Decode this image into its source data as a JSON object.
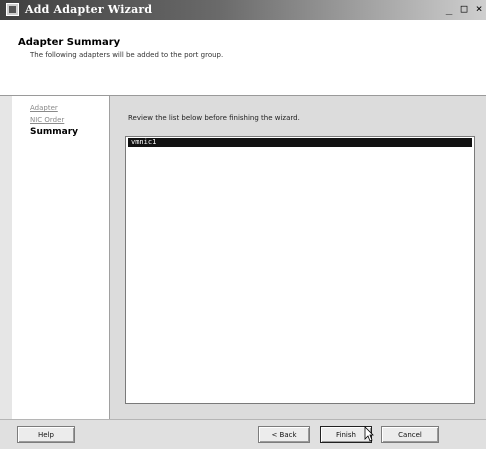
{
  "window": {
    "title": "Add Adapter Wizard",
    "controls": {
      "minimize": "_",
      "maximize": "□",
      "close": "×"
    }
  },
  "header": {
    "title": "Adapter Summary",
    "subtitle": "The following adapters will be added to the port group."
  },
  "steps": [
    {
      "label": "Adapter",
      "state": "link"
    },
    {
      "label": "NIC Order",
      "state": "link"
    },
    {
      "label": "Summary",
      "state": "active"
    }
  ],
  "content": {
    "instruction": "Review the list below before finishing the wizard.",
    "list_items": [
      "vmnic1"
    ]
  },
  "buttons": {
    "help": "Help",
    "back": "< Back",
    "finish": "Finish",
    "cancel": "Cancel"
  },
  "icons": {
    "app": "wizard-app-icon",
    "cursor": "mouse-pointer-icon"
  },
  "colors": {
    "titlebar_dark": "#3f3f3f",
    "selection": "#111111"
  }
}
